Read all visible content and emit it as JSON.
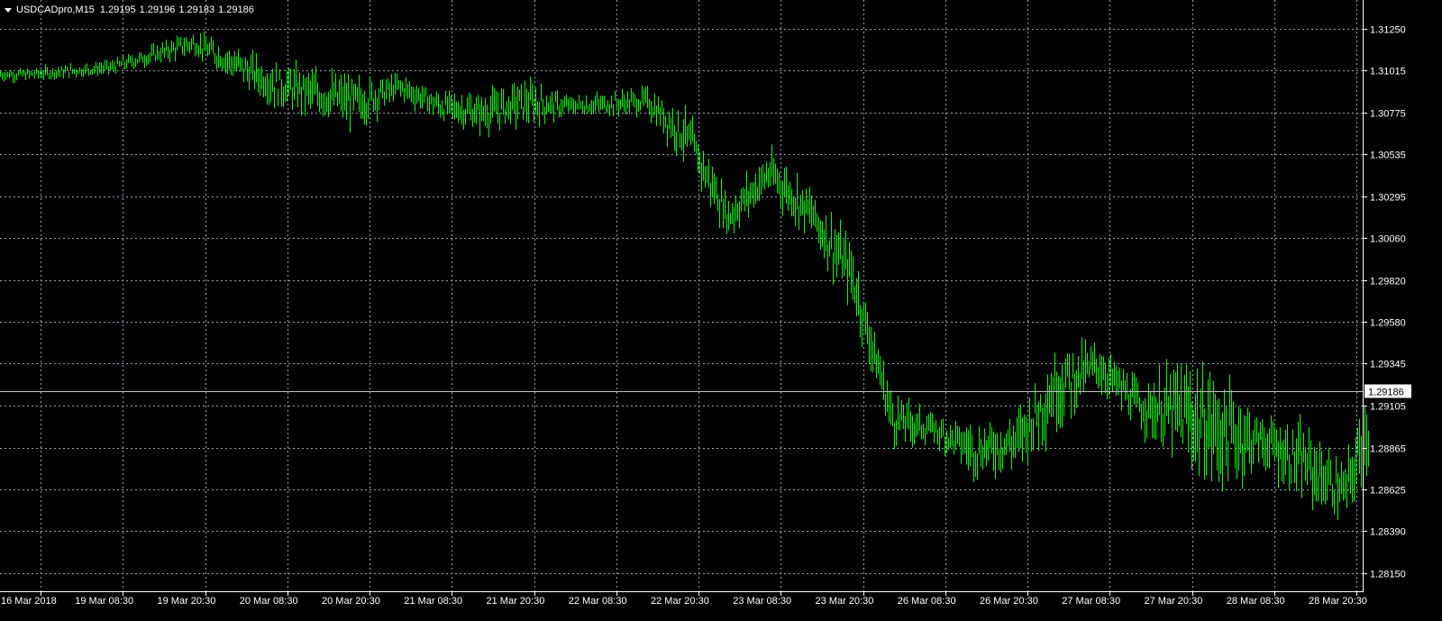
{
  "header": {
    "symbol": "USDCADpro,M15",
    "open": "1.29195",
    "high": "1.29196",
    "low": "1.29183",
    "close": "1.29186"
  },
  "current_price_label": "1.29186",
  "colors": {
    "background": "#000000",
    "bars": "#00ff00",
    "grid": "#8aa3b8",
    "axis": "#ffffff",
    "price_line": "#c0c0c0"
  },
  "chart_data": {
    "type": "line",
    "title": "USDCADpro,M15",
    "xlabel": "",
    "ylabel": "",
    "grid": true,
    "ylim": [
      1.2804,
      1.3138
    ],
    "y_ticks": [
      "1.31250",
      "1.31015",
      "1.30775",
      "1.30535",
      "1.30295",
      "1.30060",
      "1.29820",
      "1.29580",
      "1.29345",
      "1.29105",
      "1.28865",
      "1.28625",
      "1.28390",
      "1.28150"
    ],
    "x_ticks": [
      "16 Mar 2018",
      "19 Mar 08:30",
      "19 Mar 20:30",
      "20 Mar 08:30",
      "20 Mar 20:30",
      "21 Mar 08:30",
      "21 Mar 20:30",
      "22 Mar 08:30",
      "22 Mar 20:30",
      "23 Mar 08:30",
      "23 Mar 20:30",
      "26 Mar 08:30",
      "26 Mar 20:30",
      "27 Mar 08:30",
      "27 Mar 20:30",
      "28 Mar 08:30",
      "28 Mar 20:30"
    ],
    "current_price": 1.29186,
    "series": [
      {
        "x": [
          0,
          1,
          2,
          3,
          4,
          4.5,
          5,
          5.5,
          6,
          6.5,
          7,
          7.5,
          8,
          8.5,
          9,
          9.5,
          10,
          10.5,
          11,
          11.5,
          12,
          12.5,
          13,
          13.5,
          14,
          14.5,
          15,
          15.5,
          16,
          16.3
        ],
        "close": [
          1.3099,
          1.3103,
          1.3117,
          1.3093,
          1.3083,
          1.3092,
          1.3081,
          1.3077,
          1.3083,
          1.3081,
          1.3082,
          1.3084,
          1.3063,
          1.3018,
          1.3043,
          1.302,
          1.2985,
          1.2903,
          1.2897,
          1.2885,
          1.289,
          1.2922,
          1.2933,
          1.291,
          1.2906,
          1.2895,
          1.289,
          1.2877,
          1.2861,
          1.2899
        ],
        "high": [
          1.3104,
          1.311,
          1.3124,
          1.3106,
          1.3094,
          1.3096,
          1.3086,
          1.3085,
          1.3105,
          1.309,
          1.3086,
          1.3089,
          1.3069,
          1.3046,
          1.3053,
          1.303,
          1.2995,
          1.2927,
          1.2904,
          1.2896,
          1.2912,
          1.2945,
          1.2949,
          1.2932,
          1.2915,
          1.291,
          1.2898,
          1.2897,
          1.2877,
          1.2933
        ],
        "low": [
          1.3093,
          1.3098,
          1.3104,
          1.3069,
          1.3052,
          1.3074,
          1.306,
          1.3052,
          1.3067,
          1.3071,
          1.3068,
          1.3066,
          1.3025,
          1.301,
          1.3015,
          1.2986,
          1.2944,
          1.2884,
          1.288,
          1.2852,
          1.2865,
          1.2876,
          1.291,
          1.2894,
          1.2831,
          1.282,
          1.2854,
          1.2835,
          1.2832,
          1.2852
        ]
      }
    ]
  }
}
